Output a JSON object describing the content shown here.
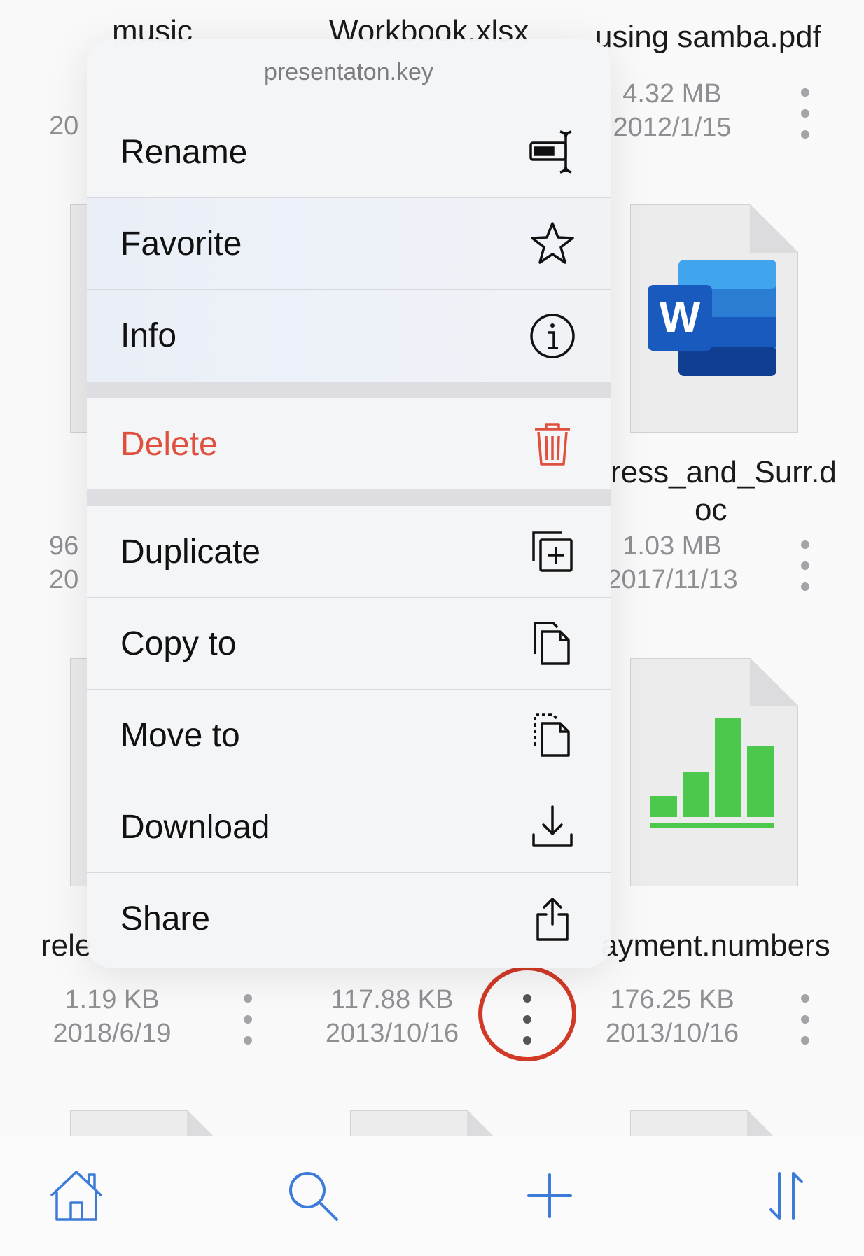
{
  "files": {
    "row1": [
      {
        "name": "music",
        "meta1": "",
        "meta2": "20"
      },
      {
        "name": "Workbook.xlsx",
        "meta1": "",
        "meta2": ""
      },
      {
        "name": "using samba.pdf",
        "meta1": "4.32 MB",
        "meta2": "2012/1/15"
      }
    ],
    "row2": [
      {
        "name": "",
        "meta1": "96",
        "meta2": "20"
      },
      {
        "name": "ress_and_Surr.d",
        "name2": "oc",
        "meta1": "1.03 MB",
        "meta2": "2017/11/13"
      }
    ],
    "row3": [
      {
        "name": "rele",
        "meta1": "1.19 KB",
        "meta2": "2018/6/19"
      },
      {
        "name": "",
        "meta1": "117.88 KB",
        "meta2": "2013/10/16"
      },
      {
        "name": "ayment.numbers",
        "meta1": "176.25 KB",
        "meta2": "2013/10/16"
      }
    ],
    "word_letter": "W"
  },
  "menu": {
    "title": "presentaton.key",
    "items": [
      {
        "label": "Rename",
        "icon": "rename-icon"
      },
      {
        "label": "Favorite",
        "icon": "star-icon"
      },
      {
        "label": "Info",
        "icon": "info-icon"
      },
      {
        "label": "Delete",
        "icon": "trash-icon"
      },
      {
        "label": "Duplicate",
        "icon": "duplicate-icon"
      },
      {
        "label": "Copy to",
        "icon": "copy-icon"
      },
      {
        "label": "Move to",
        "icon": "move-icon"
      },
      {
        "label": "Download",
        "icon": "download-icon"
      },
      {
        "label": "Share",
        "icon": "share-icon"
      }
    ]
  },
  "tabbar": {
    "items": [
      "home-icon",
      "search-icon",
      "add-icon",
      "sort-icon"
    ]
  },
  "colors": {
    "accent": "#3d7bd9",
    "danger": "#e0503f",
    "highlight": "#d13a27"
  }
}
